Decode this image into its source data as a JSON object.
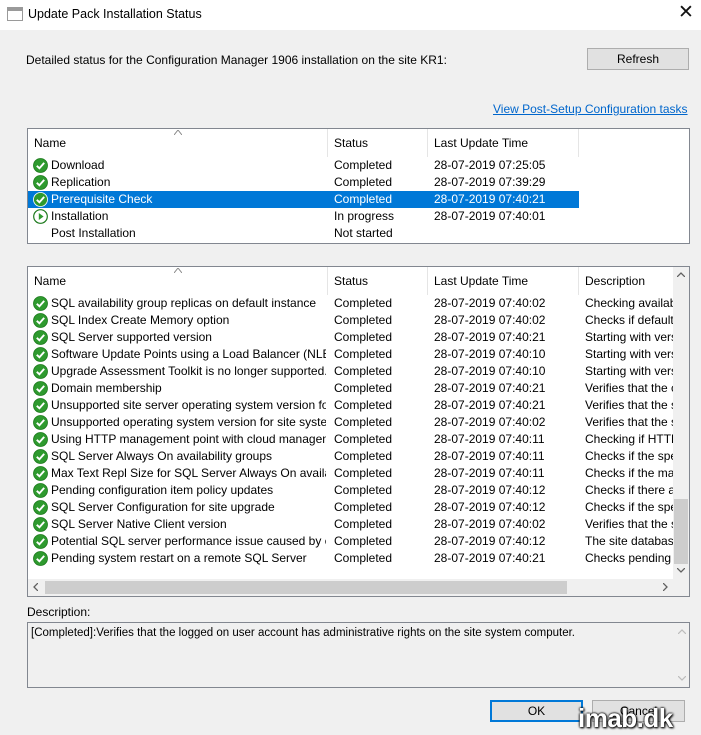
{
  "window": {
    "title": "Update Pack Installation Status",
    "close_glyph": "✕"
  },
  "header": {
    "text": "Detailed status for the Configuration Manager 1906 installation on the site KR1:"
  },
  "buttons": {
    "refresh": "Refresh",
    "ok": "OK",
    "cancel": "Cancel"
  },
  "link": {
    "text": "View Post-Setup Configuration tasks"
  },
  "phases": {
    "columns": [
      "Name",
      "Status",
      "Last Update Time"
    ],
    "rows": [
      {
        "icon": "check-icon",
        "name": "Download",
        "status": "Completed",
        "time": "28-07-2019 07:25:05"
      },
      {
        "icon": "check-icon",
        "name": "Replication",
        "status": "Completed",
        "time": "28-07-2019 07:39:29"
      },
      {
        "icon": "check-icon",
        "name": "Prerequisite Check",
        "status": "Completed",
        "time": "28-07-2019 07:40:21",
        "selected": true
      },
      {
        "icon": "play-icon",
        "name": "Installation",
        "status": "In progress",
        "time": "28-07-2019 07:40:01"
      },
      {
        "icon": "",
        "name": "Post Installation",
        "status": "Not started",
        "time": ""
      }
    ]
  },
  "details": {
    "columns": [
      "Name",
      "Status",
      "Last Update Time",
      "Description"
    ],
    "rows": [
      {
        "name": "SQL availability group replicas on default instance",
        "status": "Completed",
        "time": "28-07-2019 07:40:02",
        "desc": "Checking availabili"
      },
      {
        "name": "SQL Index Create Memory option",
        "status": "Completed",
        "time": "28-07-2019 07:40:02",
        "desc": "Checks if default v"
      },
      {
        "name": "SQL Server supported version",
        "status": "Completed",
        "time": "28-07-2019 07:40:21",
        "desc": "Starting with versic"
      },
      {
        "name": "Software Update Points using a Load Balancer (NLB/HL...",
        "status": "Completed",
        "time": "28-07-2019 07:40:10",
        "desc": "Starting with versic"
      },
      {
        "name": "Upgrade Assessment Toolkit is no longer supported.",
        "status": "Completed",
        "time": "28-07-2019 07:40:10",
        "desc": "Starting with versic"
      },
      {
        "name": "Domain membership",
        "status": "Completed",
        "time": "28-07-2019 07:40:21",
        "desc": "Verifies that the co"
      },
      {
        "name": "Unsupported site server operating system version for Set...",
        "status": "Completed",
        "time": "28-07-2019 07:40:21",
        "desc": "Verifies that the sit"
      },
      {
        "name": "Unsupported operating system version for site system role",
        "status": "Completed",
        "time": "28-07-2019 07:40:02",
        "desc": "Verifies that the sit"
      },
      {
        "name": "Using HTTP management point with cloud management ...",
        "status": "Completed",
        "time": "28-07-2019 07:40:11",
        "desc": "Checking if HTTP"
      },
      {
        "name": "SQL Server Always On availability groups",
        "status": "Completed",
        "time": "28-07-2019 07:40:11",
        "desc": "Checks if the spec"
      },
      {
        "name": "Max Text Repl Size for SQL Server Always On availabilit...",
        "status": "Completed",
        "time": "28-07-2019 07:40:11",
        "desc": "Checks if the max"
      },
      {
        "name": "Pending configuration item policy updates",
        "status": "Completed",
        "time": "28-07-2019 07:40:12",
        "desc": "Checks if there are"
      },
      {
        "name": "SQL Server Configuration for site upgrade",
        "status": "Completed",
        "time": "28-07-2019 07:40:12",
        "desc": "Checks if the spec"
      },
      {
        "name": "SQL Server Native Client version",
        "status": "Completed",
        "time": "28-07-2019 07:40:02",
        "desc": "Verifies that the sit"
      },
      {
        "name": "Potential SQL server performance issue caused by chan...",
        "status": "Completed",
        "time": "28-07-2019 07:40:12",
        "desc": "The site database"
      },
      {
        "name": "Pending system restart on a remote SQL Server",
        "status": "Completed",
        "time": "28-07-2019 07:40:21",
        "desc": "Checks pending sy"
      }
    ]
  },
  "description": {
    "label": "Description:",
    "text": "[Completed]:Verifies that the logged on user account has administrative rights on the site system computer."
  },
  "watermark": "imab.dk",
  "colors": {
    "accent": "#0078d7",
    "check": "#2e9a2e",
    "link": "#0066cc"
  }
}
